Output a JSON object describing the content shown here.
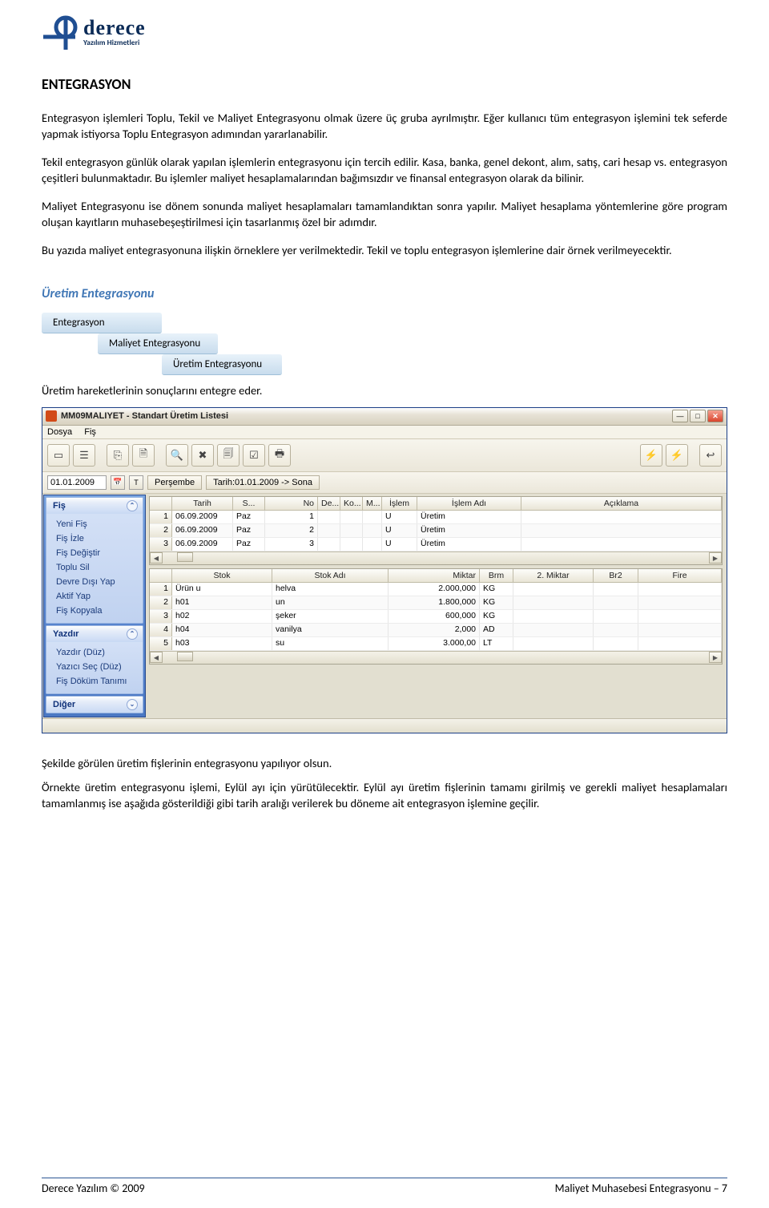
{
  "logo": {
    "brand": "derece",
    "sub": "Yazılım Hizmetleri"
  },
  "heading": "ENTEGRASYON",
  "para1": "Entegrasyon işlemleri Toplu, Tekil ve Maliyet Entegrasyonu olmak üzere üç gruba ayrılmıştır. Eğer kullanıcı tüm entegrasyon işlemini tek seferde yapmak istiyorsa Toplu Entegrasyon adımından yararlanabilir.",
  "para2": "Tekil entegrasyon günlük olarak yapılan işlemlerin entegrasyonu için tercih edilir. Kasa, banka, genel dekont, alım, satış, cari hesap vs. entegrasyon çeşitleri bulunmaktadır. Bu işlemler maliyet hesaplamalarından bağımsızdır ve finansal entegrasyon olarak da bilinir.",
  "para3": "Maliyet Entegrasyonu ise dönem sonunda maliyet hesaplamaları tamamlandıktan sonra yapılır. Maliyet hesaplama yöntemlerine göre program oluşan kayıtların muhasebeşeştirilmesi için tasarlanmış özel bir adımdır.",
  "para4": "Bu yazıda maliyet entegrasyonuna ilişkin örneklere yer verilmektedir. Tekil ve toplu entegrasyon işlemlerine dair örnek verilmeyecektir.",
  "subhead": "Üretim Entegrasyonu",
  "pills": {
    "p1": "Entegrasyon",
    "p2": "Maliyet Entegrasyonu",
    "p3": "Üretim Entegrasyonu"
  },
  "caption": "Üretim hareketlerinin sonuçlarını entegre eder.",
  "window": {
    "title": "MM09MALIYET - Standart Üretim Listesi",
    "menus": [
      "Dosya",
      "Fiş"
    ],
    "date": "01.01.2009",
    "t_btn": "T",
    "day": "Perşembe",
    "range": "Tarih:01.01.2009 -> Sona",
    "side": {
      "g1": {
        "title": "Fiş",
        "items": [
          "Yeni Fiş",
          "Fiş İzle",
          "Fiş Değiştir",
          "Toplu Sil",
          "Devre Dışı Yap",
          "Aktif Yap",
          "Fiş Kopyala"
        ]
      },
      "g2": {
        "title": "Yazdır",
        "items": [
          "Yazdır (Düz)",
          "Yazıcı Seç (Düz)",
          "Fiş Döküm Tanımı"
        ]
      },
      "g3": {
        "title": "Diğer"
      }
    },
    "grid1": {
      "cols": [
        "Tarih",
        "S...",
        "No",
        "De...",
        "Ko...",
        "M...",
        "İşlem",
        "İşlem Adı",
        "Açıklama"
      ],
      "rows": [
        {
          "n": "1",
          "tarih": "06.09.2009",
          "s": "Paz",
          "no": "1",
          "de": "",
          "ko": "",
          "m": "",
          "islem": "U",
          "ad": "Üretim"
        },
        {
          "n": "2",
          "tarih": "06.09.2009",
          "s": "Paz",
          "no": "2",
          "de": "",
          "ko": "",
          "m": "",
          "islem": "U",
          "ad": "Üretim"
        },
        {
          "n": "3",
          "tarih": "06.09.2009",
          "s": "Paz",
          "no": "3",
          "de": "",
          "ko": "",
          "m": "",
          "islem": "U",
          "ad": "Üretim"
        }
      ]
    },
    "grid2": {
      "cols": [
        "Stok",
        "Stok Adı",
        "Miktar",
        "Brm",
        "2. Miktar",
        "Br2",
        "Fire"
      ],
      "rows": [
        {
          "n": "1",
          "stok": "Ürün  u",
          "ad": "helva",
          "mik": "2.000,000",
          "brm": "KG",
          "mik2": "",
          "br2": "",
          "fire": ""
        },
        {
          "n": "2",
          "stok": "h01",
          "ad": "un",
          "mik": "1.800,000",
          "brm": "KG",
          "mik2": "",
          "br2": "",
          "fire": ""
        },
        {
          "n": "3",
          "stok": "h02",
          "ad": "şeker",
          "mik": "600,000",
          "brm": "KG",
          "mik2": "",
          "br2": "",
          "fire": ""
        },
        {
          "n": "4",
          "stok": "h04",
          "ad": "vanilya",
          "mik": "2,000",
          "brm": "AD",
          "mik2": "",
          "br2": "",
          "fire": ""
        },
        {
          "n": "5",
          "stok": "h03",
          "ad": "su",
          "mik": "3.000,00",
          "brm": "LT",
          "mik2": "",
          "br2": "",
          "fire": ""
        }
      ]
    }
  },
  "after1": "Şekilde görülen üretim fişlerinin entegrasyonu yapılıyor olsun.",
  "after2": "Örnekte üretim entegrasyonu işlemi, Eylül ayı için yürütülecektir. Eylül ayı üretim fişlerinin tamamı girilmiş ve gerekli maliyet hesaplamaları tamamlanmış ise aşağıda gösterildiği gibi tarih aralığı verilerek bu döneme ait entegrasyon işlemine geçilir.",
  "footer": {
    "left": "Derece Yazılım © 2009",
    "right": "Maliyet Muhasebesi Entegrasyonu – 7"
  }
}
